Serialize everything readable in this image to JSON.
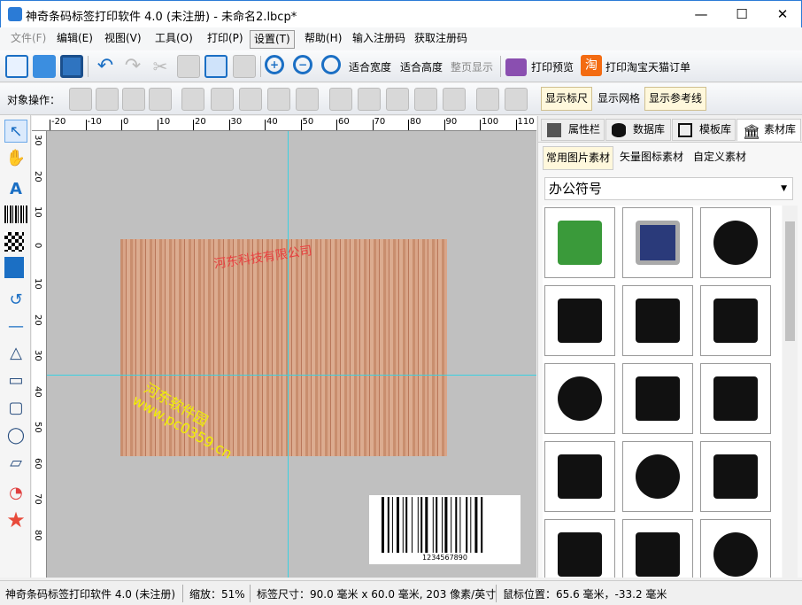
{
  "window": {
    "title": "神奇条码标签打印软件 4.0 (未注册) - 未命名2.lbcp*",
    "minimize": "—",
    "maximize": "☐",
    "close": "✕"
  },
  "menu": [
    "文件(F)",
    "编辑(E)",
    "视图(V)",
    "工具(O)",
    "打印(P)",
    "设置(T)",
    "帮助(H)",
    "输入注册码",
    "获取注册码"
  ],
  "toolbar": {
    "fit_width": "适合宽度",
    "fit_height": "适合高度",
    "full_page": "整页显示",
    "print_preview": "打印预览",
    "taobao_icon": "淘",
    "print_taobao": "打印淘宝天猫订单"
  },
  "toolbar2": {
    "label": "对象操作：",
    "show_ruler": "显示标尺",
    "show_grid": "显示网格",
    "show_guides": "显示参考线"
  },
  "ruler": {
    "top": [
      "-20",
      "-10",
      "0",
      "10",
      "20",
      "30",
      "40",
      "50",
      "60",
      "70",
      "80",
      "90",
      "100",
      "110"
    ],
    "left": [
      "30",
      "20",
      "10",
      "0",
      "10",
      "20",
      "30",
      "40",
      "50",
      "60",
      "70",
      "80"
    ]
  },
  "label": {
    "red_text": "河东科技有限公司",
    "watermark_line1": "河东软件园",
    "watermark_line2": "www.pc0359.cn",
    "barcode_text": "1234567890"
  },
  "panel": {
    "tabs": [
      "属性栏",
      "数据库",
      "模板库",
      "素材库"
    ],
    "subtabs": [
      "常用图片素材",
      "矢量图标素材",
      "自定义素材"
    ],
    "category": "办公符号"
  },
  "status": {
    "app": "神奇条码标签打印软件 4.0 (未注册)",
    "zoom": "缩放：51%",
    "size": "标签尺寸：90.0 毫米 x 60.0 毫米, 203 像素/英寸",
    "mouse": "鼠标位置：65.6 毫米，-33.2 毫米"
  },
  "colors": {
    "accent": "#1b6fc4",
    "guide": "#3ad0e0",
    "toggle_bg": "#fff8dc"
  }
}
